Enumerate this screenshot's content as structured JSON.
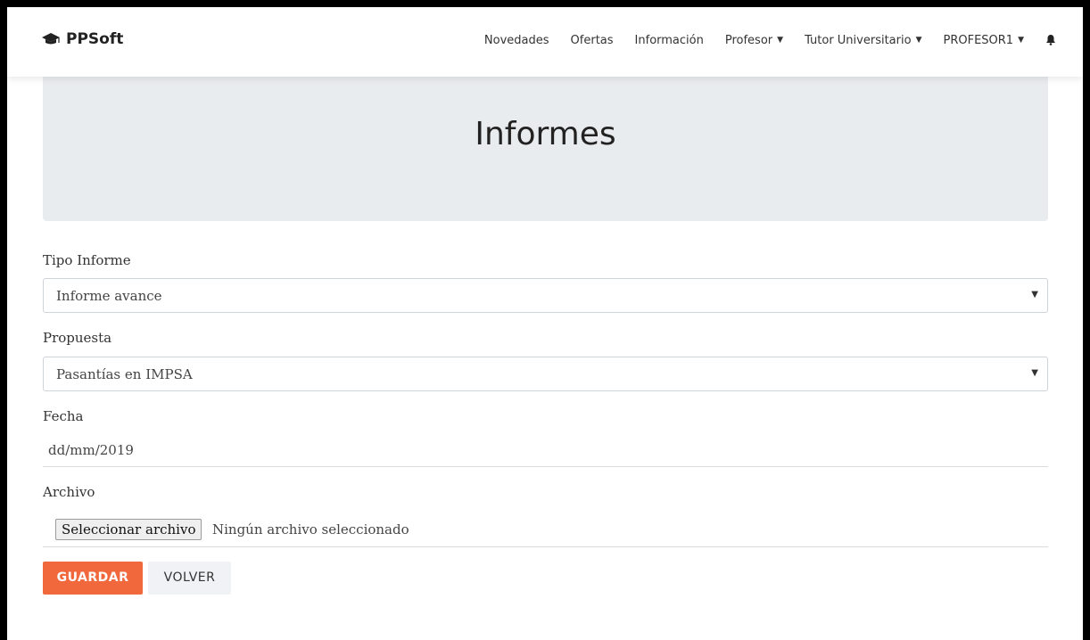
{
  "navbar": {
    "brand": "PPSoft",
    "brand_icon": "graduation-cap-icon",
    "items": [
      {
        "label": "Novedades"
      },
      {
        "label": "Ofertas"
      },
      {
        "label": "Información"
      },
      {
        "label": "Profesor"
      },
      {
        "label": "Tutor Universitario"
      },
      {
        "label": "PROFESOR1"
      }
    ],
    "bell_icon": "bell-icon"
  },
  "page": {
    "title": "Informes"
  },
  "form": {
    "tipo_informe": {
      "label": "Tipo Informe",
      "value": "Informe avance"
    },
    "propuesta": {
      "label": "Propuesta",
      "value": "Pasantías en IMPSA"
    },
    "fecha": {
      "label": "Fecha",
      "value": "dd/mm/2019"
    },
    "archivo": {
      "label": "Archivo",
      "button": "Seleccionar archivo",
      "status": "Ningún archivo seleccionado"
    },
    "save_label": "GUARDAR",
    "back_label": "VOLVER"
  },
  "colors": {
    "primary": "#f1683d",
    "jumbotron_bg": "#e9ecef"
  }
}
